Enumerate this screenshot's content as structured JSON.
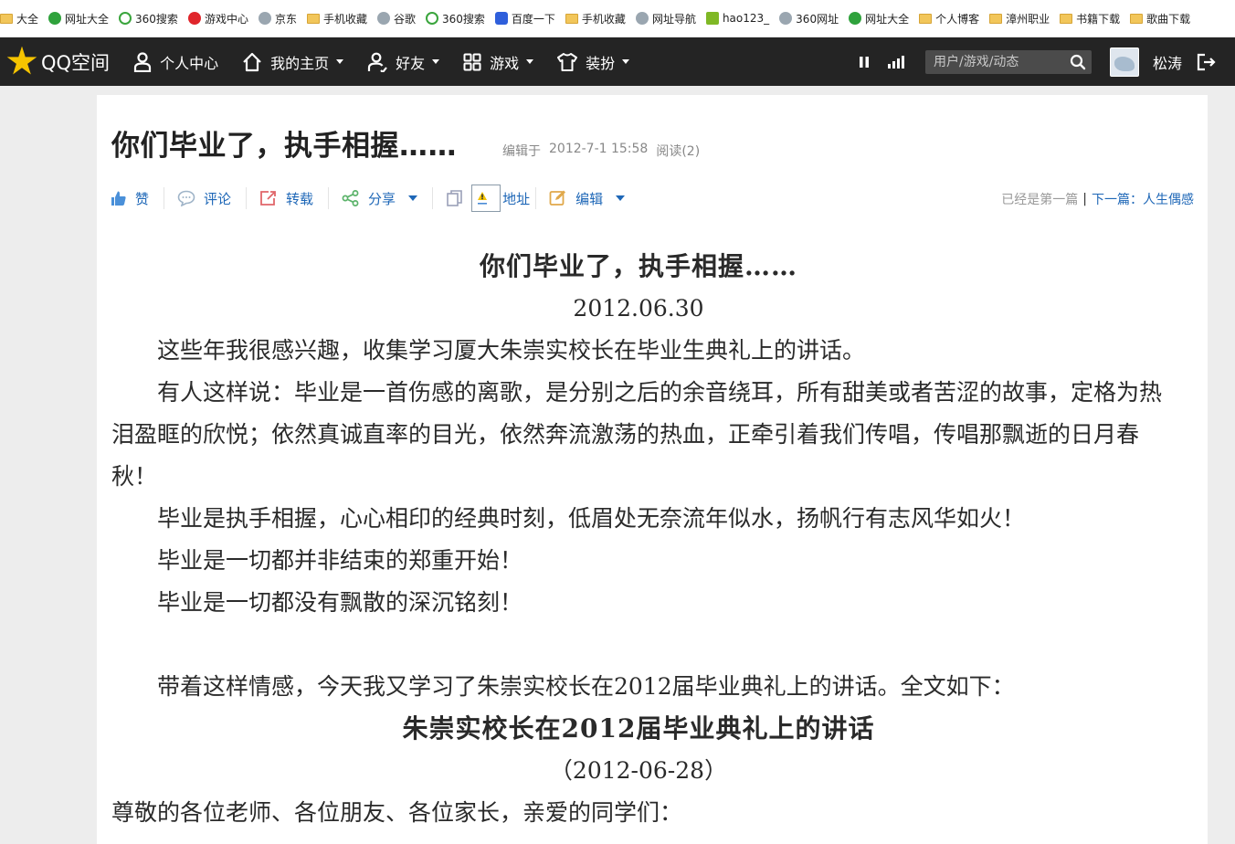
{
  "bookmarks": [
    {
      "label": "大全",
      "icon": "folder-icon"
    },
    {
      "label": "网址大全",
      "icon": "green-star-icon"
    },
    {
      "label": "360搜索",
      "icon": "search-360-icon"
    },
    {
      "label": "游戏中心",
      "icon": "game-center-icon"
    },
    {
      "label": "京东",
      "icon": "globe-icon"
    },
    {
      "label": "手机收藏",
      "icon": "folder-icon"
    },
    {
      "label": "谷歌",
      "icon": "globe-icon"
    },
    {
      "label": "360搜索",
      "icon": "search-360-icon"
    },
    {
      "label": "百度一下",
      "icon": "baidu-paw-icon"
    },
    {
      "label": "手机收藏",
      "icon": "folder-icon"
    },
    {
      "label": "网址导航",
      "icon": "globe-icon"
    },
    {
      "label": "hao123_",
      "icon": "hao123-icon"
    },
    {
      "label": "360网址",
      "icon": "globe-icon"
    },
    {
      "label": "网址大全",
      "icon": "green-star-icon"
    },
    {
      "label": "个人博客",
      "icon": "folder-icon"
    },
    {
      "label": "漳州职业",
      "icon": "folder-icon"
    },
    {
      "label": "书籍下载",
      "icon": "folder-icon"
    },
    {
      "label": "歌曲下载",
      "icon": "folder-icon"
    }
  ],
  "nav": {
    "logo_text": "QQ空间",
    "items": [
      {
        "label": "个人中心",
        "icon": "person-icon",
        "dropdown": false
      },
      {
        "label": "我的主页",
        "icon": "home-icon",
        "dropdown": true
      },
      {
        "label": "好友",
        "icon": "friends-icon",
        "dropdown": true
      },
      {
        "label": "游戏",
        "icon": "grid-icon",
        "dropdown": true
      },
      {
        "label": "装扮",
        "icon": "shirt-icon",
        "dropdown": true
      }
    ],
    "search_placeholder": "用户/游戏/动态",
    "username": "松涛"
  },
  "article": {
    "title": "你们毕业了，执手相握……",
    "edited_label": "编辑于",
    "edited_time": "2012-7-1 15:58",
    "reads": "阅读(2)",
    "toolbar": {
      "like": "赞",
      "comment": "评论",
      "repost": "转载",
      "share": "分享",
      "address": "地址",
      "edit": "编辑"
    },
    "first_post": "已经是第一篇",
    "link_separator": "|",
    "next_post": "下一篇：人生偶感",
    "paragraphs": [
      "你们毕业了，执手相握……",
      "2012.06.30",
      "这些年我很感兴趣，收集学习厦大朱崇实校长在毕业生典礼上的讲话。",
      "有人这样说：毕业是一首伤感的离歌，是分别之后的余音绕耳，所有甜美或者苦涩的故事，定格为热泪盈眶的欣悦；依然真诚直率的目光，依然奔流激荡的热血，正牵引着我们传唱，传唱那飘逝的日月春秋！",
      "毕业是执手相握，心心相印的经典时刻，低眉处无奈流年似水，扬帆行有志风华如火！",
      "毕业是一切都并非结束的郑重开始！",
      "毕业是一切都没有飘散的深沉铭刻！",
      "",
      "带着这样情感，今天我又学习了朱崇实校长在2012届毕业典礼上的讲话。全文如下：",
      "朱崇实校长在2012届毕业典礼上的讲话",
      "（2012-06-28）",
      "尊敬的各位老师、各位朋友、各位家长，亲爱的同学们："
    ]
  }
}
